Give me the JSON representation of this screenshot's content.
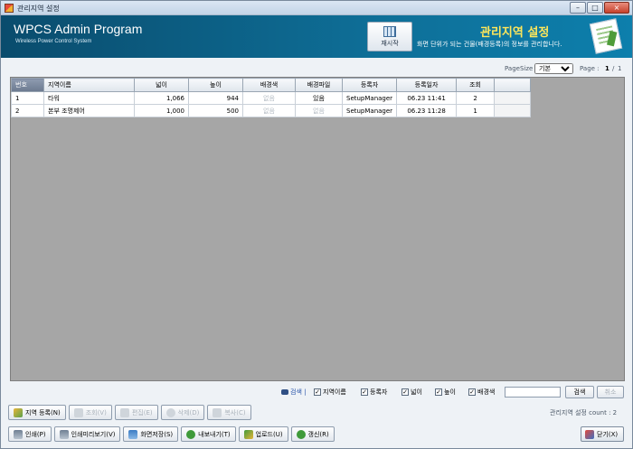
{
  "window": {
    "title": "관리지역 설정",
    "minimize": "–",
    "maximize": "□",
    "close": "×"
  },
  "header": {
    "brand": "WPCS Admin Program",
    "brand_sub": "Wireless Power Control System",
    "restart_label": "재시작",
    "page_title": "관리지역 설정",
    "page_desc": "화면 단위가 되는 건물(배경등록)의 정보를 관리합니다."
  },
  "pager": {
    "page_size_label": "PageSize",
    "page_size_value": "기본",
    "page_label": "Page :",
    "current_page": "1",
    "separator": "/",
    "total_pages": "1"
  },
  "table": {
    "columns": [
      "번호",
      "지역이름",
      "넓이",
      "높이",
      "배경색",
      "배경파일",
      "등록자",
      "등록일자",
      "조회"
    ],
    "rows": [
      [
        "1",
        "타워",
        "1,066",
        "944",
        "없음",
        "있음",
        "SetupManager",
        "06.23 11:41",
        "2"
      ],
      [
        "2",
        "본부 조명제어",
        "1,000",
        "500",
        "없음",
        "없음",
        "SetupManager",
        "06.23 11:28",
        "1"
      ]
    ]
  },
  "search": {
    "link": "검색",
    "divider": "|",
    "filters": [
      "지역이름",
      "등록자",
      "넓이",
      "높이",
      "배경색"
    ],
    "check_mark": "✓",
    "search_button": "검색",
    "cancel_button": "취소"
  },
  "toolbar1": [
    "지역 등록(N)",
    "조회(V)",
    "편집(E)",
    "삭제(D)",
    "복사(C)"
  ],
  "toolbar2": [
    "인쇄(P)",
    "인쇄미리보기(V)",
    "화면저장(S)",
    "내보내기(T)",
    "업로드(U)",
    "갱신(R)"
  ],
  "count_text": "관리지역 설정 count : 2",
  "close_label": "닫기(X)",
  "colors": {
    "header_dark": "#0a4c6d",
    "header_light": "#0d7fac",
    "title_yellow": "#ffe75a",
    "grid_bg": "#a6a6a6"
  }
}
